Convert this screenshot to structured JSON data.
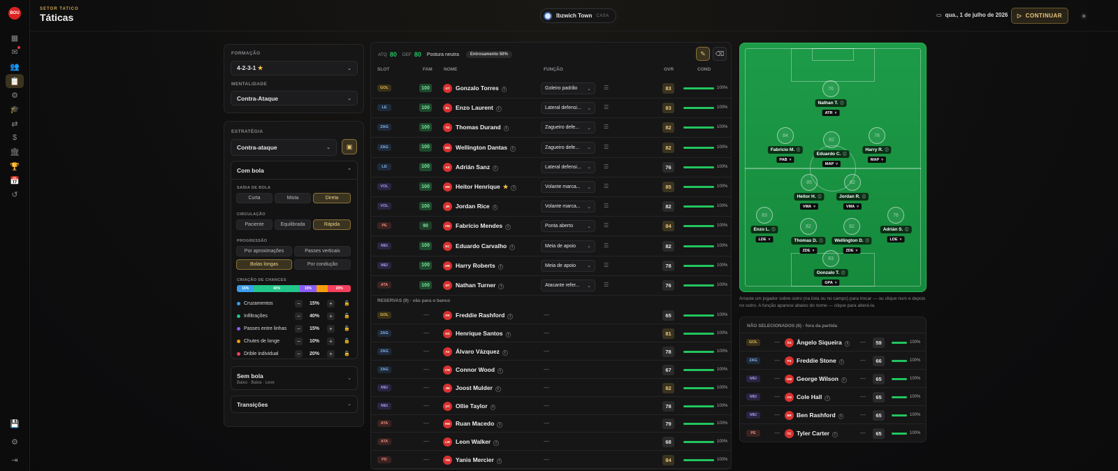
{
  "rail": {
    "logo": "BOU"
  },
  "header": {
    "kicker": "SETOR TATICO",
    "title": "Táticas",
    "club": "Ibzwich Town",
    "venue": "CASA",
    "date": "qua., 1 de julho de 2026",
    "continue": "CONTINUAR"
  },
  "formation": {
    "label": "FORMAÇÃO",
    "value": "4-2-3-1",
    "mentality_label": "MENTALIDADE",
    "mentality": "Contra-Ataque"
  },
  "strategy": {
    "label": "ESTRATÉGIA",
    "value": "Contra-ataque",
    "section": "Com bola",
    "build_label": "SAÍDA DE BOLA",
    "build": [
      "Curta",
      "Mista",
      "Direta"
    ],
    "circ_label": "CIRCULAÇÃO",
    "circ": [
      "Paciente",
      "Equilibrada",
      "Rápida"
    ],
    "prog_label": "PROGRESSÃO",
    "prog": [
      "Por aproximações",
      "Passes verticais",
      "Bolas longas",
      "Por condução"
    ],
    "chances_label": "CRIAÇÃO DE CHANCES",
    "chances": [
      {
        "name": "Cruzamentos",
        "pct": "15%",
        "color": "#3b9eea",
        "value": 15
      },
      {
        "name": "Infiltrações",
        "pct": "40%",
        "color": "#22c58a",
        "value": 40
      },
      {
        "name": "Passes entre linhas",
        "pct": "15%",
        "color": "#8b5cf6",
        "value": 15
      },
      {
        "name": "Chutes de longe",
        "pct": "10%",
        "color": "#f59e0b",
        "value": 10
      },
      {
        "name": "Drible individual",
        "pct": "20%",
        "color": "#f43f5e",
        "value": 20
      }
    ],
    "no_ball": "Sem bola",
    "no_ball_sub": "Baixo · Baixa · Leve",
    "transitions": "Transições"
  },
  "table": {
    "atq_label": "ATQ",
    "atq": "80",
    "def_label": "DEF",
    "def": "80",
    "posture": "Postura neutra",
    "cohesion": "Entrosamento 50%",
    "cols": [
      "SLOT",
      "FAM",
      "NOME",
      "FUNÇÃO",
      "OVR",
      "COND"
    ],
    "starters": [
      {
        "slot": "GOL",
        "fam": "100",
        "ini": "GT",
        "name": "Gonzalo Torres",
        "role": "Goleiro padrão",
        "ovr": "83",
        "cond": "100%"
      },
      {
        "slot": "LE",
        "fam": "100",
        "ini": "EL",
        "name": "Enzo Laurent",
        "role": "Lateral defensi...",
        "ovr": "83",
        "cond": "100%"
      },
      {
        "slot": "ZAG",
        "fam": "100",
        "ini": "TD",
        "name": "Thomas Durand",
        "role": "Zagueiro defe...",
        "ovr": "82",
        "cond": "100%"
      },
      {
        "slot": "ZAG",
        "fam": "100",
        "ini": "WD",
        "name": "Wellington Dantas",
        "role": "Zagueiro defe...",
        "ovr": "82",
        "cond": "100%"
      },
      {
        "slot": "LD",
        "fam": "100",
        "ini": "AS",
        "name": "Adrián Sanz",
        "role": "Lateral defensi...",
        "ovr": "76",
        "cond": "100%"
      },
      {
        "slot": "VOL",
        "fam": "100",
        "ini": "HH",
        "name": "Heitor Henrique",
        "role": "Volante marca...",
        "ovr": "85",
        "cond": "100%",
        "star": "★"
      },
      {
        "slot": "VOL",
        "fam": "100",
        "ini": "JR",
        "name": "Jordan Rice",
        "role": "Volante marca...",
        "ovr": "82",
        "cond": "100%"
      },
      {
        "slot": "PE",
        "fam": "90",
        "ini": "FM",
        "name": "Fabrício Mendes",
        "role": "Ponta aberto",
        "ovr": "84",
        "cond": "100%"
      },
      {
        "slot": "MEI",
        "fam": "100",
        "ini": "EC",
        "name": "Eduardo Carvalho",
        "role": "Meia de apoio",
        "ovr": "82",
        "cond": "100%"
      },
      {
        "slot": "MEI",
        "fam": "100",
        "ini": "HR",
        "name": "Harry Roberts",
        "role": "Meia de apoio",
        "ovr": "78",
        "cond": "100%"
      },
      {
        "slot": "ATA",
        "fam": "100",
        "ini": "NT",
        "name": "Nathan Turner",
        "role": "Atacante refer...",
        "ovr": "76",
        "cond": "100%"
      }
    ],
    "reserves_label": "RESERVAS (9) · vão para o banco",
    "reserves": [
      {
        "slot": "GOL",
        "ini": "FR",
        "name": "Freddie Rashford",
        "ovr": "65",
        "cond": "100%"
      },
      {
        "slot": "ZAG",
        "ini": "HS",
        "name": "Henrique Santos",
        "ovr": "81",
        "cond": "100%"
      },
      {
        "slot": "ZAG",
        "ini": "AV",
        "name": "Álvaro Vázquez",
        "ovr": "78",
        "cond": "100%"
      },
      {
        "slot": "ZAG",
        "ini": "CW",
        "name": "Connor Wood",
        "ovr": "67",
        "cond": "100%"
      },
      {
        "slot": "MEI",
        "ini": "JM",
        "name": "Joost Mulder",
        "ovr": "82",
        "cond": "100%"
      },
      {
        "slot": "MEI",
        "ini": "OT",
        "name": "Ollie Taylor",
        "ovr": "78",
        "cond": "100%"
      },
      {
        "slot": "ATA",
        "ini": "RM",
        "name": "Ruan Macedo",
        "ovr": "79",
        "cond": "100%"
      },
      {
        "slot": "ATA",
        "ini": "LW",
        "name": "Leon Walker",
        "ovr": "68",
        "cond": "100%"
      },
      {
        "slot": "PD",
        "ini": "YM",
        "name": "Yanis Mercier",
        "ovr": "84",
        "cond": "100%"
      }
    ]
  },
  "pitch": {
    "help": "Arraste um jogador sobre outro (na lista ou no campo) para trocar — ou clique num e depois no outro. A função aparece abaixo do nome — clique para alterá-la.",
    "players": [
      {
        "n": "76",
        "name": "Nathan T.",
        "role": "ATR"
      },
      {
        "n": "84",
        "name": "Fabrício M.",
        "role": "PAB"
      },
      {
        "n": "82",
        "name": "Eduardo C.",
        "role": "MAP"
      },
      {
        "n": "78",
        "name": "Harry R.",
        "role": "MAP"
      },
      {
        "n": "85",
        "name": "Heitor H.",
        "role": "VMA"
      },
      {
        "n": "82",
        "name": "Jordan R.",
        "role": "VMA"
      },
      {
        "n": "83",
        "name": "Enzo L.",
        "role": "LDE"
      },
      {
        "n": "82",
        "name": "Thomas D.",
        "role": "ZDE"
      },
      {
        "n": "82",
        "name": "Wellington D.",
        "role": "ZDE"
      },
      {
        "n": "76",
        "name": "Adrián S.",
        "role": "LDE"
      },
      {
        "n": "83",
        "name": "Gonzalo T.",
        "role": "GPA"
      }
    ]
  },
  "unselected": {
    "label": "NÃO SELECIONADOS (6) · fora da partida",
    "rows": [
      {
        "slot": "GOL",
        "ini": "ÂS",
        "name": "Ângelo Siqueira",
        "ovr": "59",
        "cond": "100%"
      },
      {
        "slot": "ZAG",
        "ini": "FS",
        "name": "Freddie Stone",
        "ovr": "66",
        "cond": "100%"
      },
      {
        "slot": "MEI",
        "ini": "GW",
        "name": "George Wilson",
        "ovr": "65",
        "cond": "100%"
      },
      {
        "slot": "MEI",
        "ini": "CH",
        "name": "Cole Hall",
        "ovr": "65",
        "cond": "100%"
      },
      {
        "slot": "MEI",
        "ini": "BR",
        "name": "Ben Rashford",
        "ovr": "65",
        "cond": "100%"
      },
      {
        "slot": "PE",
        "ini": "TC",
        "name": "Tyler Carter",
        "ovr": "65",
        "cond": "100%"
      }
    ]
  },
  "slot_colors": {
    "GOL": [
      "#3a3118",
      "#e0b857"
    ],
    "LE": [
      "#1d2a3a",
      "#8bb4e8"
    ],
    "LD": [
      "#1d2a3a",
      "#8bb4e8"
    ],
    "ZAG": [
      "#1d2a3a",
      "#8bb4e8"
    ],
    "VOL": [
      "#2a2440",
      "#a996e8"
    ],
    "MEI": [
      "#2a2440",
      "#a996e8"
    ],
    "PE": [
      "#3a2220",
      "#e88a7f"
    ],
    "PD": [
      "#3a2220",
      "#e88a7f"
    ],
    "ATA": [
      "#3a2220",
      "#e88a7f"
    ]
  }
}
